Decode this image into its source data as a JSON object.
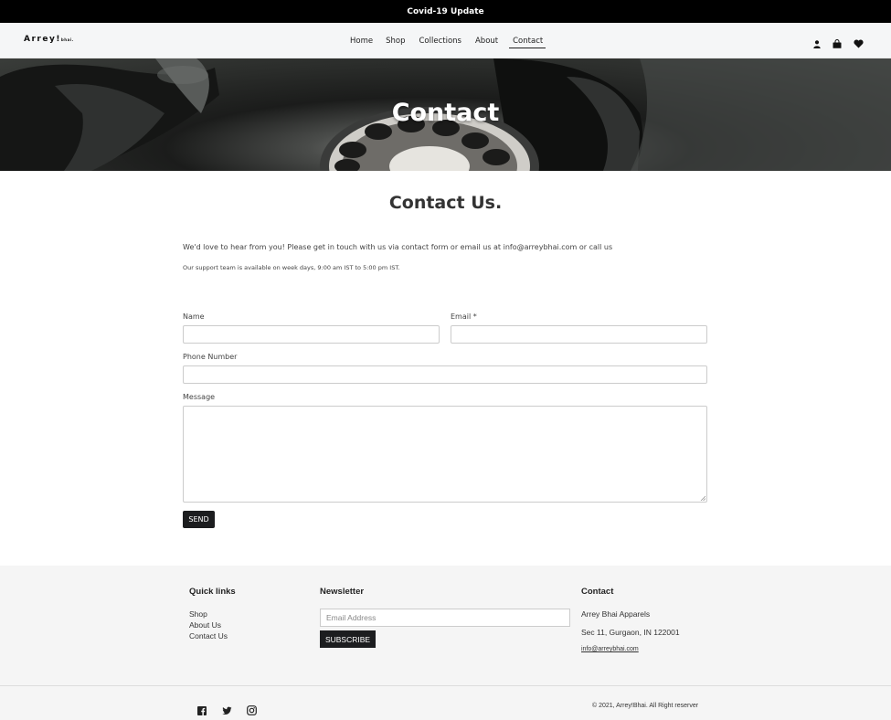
{
  "announcement": "Covid-19 Update",
  "header": {
    "logo_main": "Arrey!",
    "logo_sub": "bhai.",
    "nav": [
      "Home",
      "Shop",
      "Collections",
      "About",
      "Contact"
    ],
    "active_nav": "Contact",
    "icons": [
      "user-icon",
      "bag-icon",
      "heart-icon"
    ]
  },
  "hero": {
    "title": "Contact"
  },
  "main": {
    "heading": "Contact Us.",
    "intro": "We'd love to hear from you! Please get in touch with us via contact form or email us at info@arreybhai.com or call us",
    "support": "Our support team is available on week days, 9:00 am IST to 5:00 pm IST."
  },
  "form": {
    "name_label": "Name",
    "email_label": "Email *",
    "phone_label": "Phone Number",
    "message_label": "Message",
    "send_label": "SEND"
  },
  "footer": {
    "quick_links_title": "Quick links",
    "quick_links": [
      "Shop",
      "About Us",
      "Contact Us"
    ],
    "newsletter_title": "Newsletter",
    "newsletter_placeholder": "Email Address",
    "subscribe_label": "SUBSCRIBE",
    "contact_title": "Contact",
    "company": "Arrey Bhai Apparels",
    "address": "Sec 11, Gurgaon, IN 122001",
    "email": "info@arreybhai.com",
    "social_icons": [
      "facebook-icon",
      "twitter-icon",
      "instagram-icon"
    ],
    "copyright": "© 2021, Arrey!Bhai. All Right reserver"
  },
  "colors": {
    "dark": "#1c1d1f",
    "announcement_bg": "#000000",
    "header_bg": "#f5f6f7",
    "footer_bg": "#f5f5f5"
  }
}
